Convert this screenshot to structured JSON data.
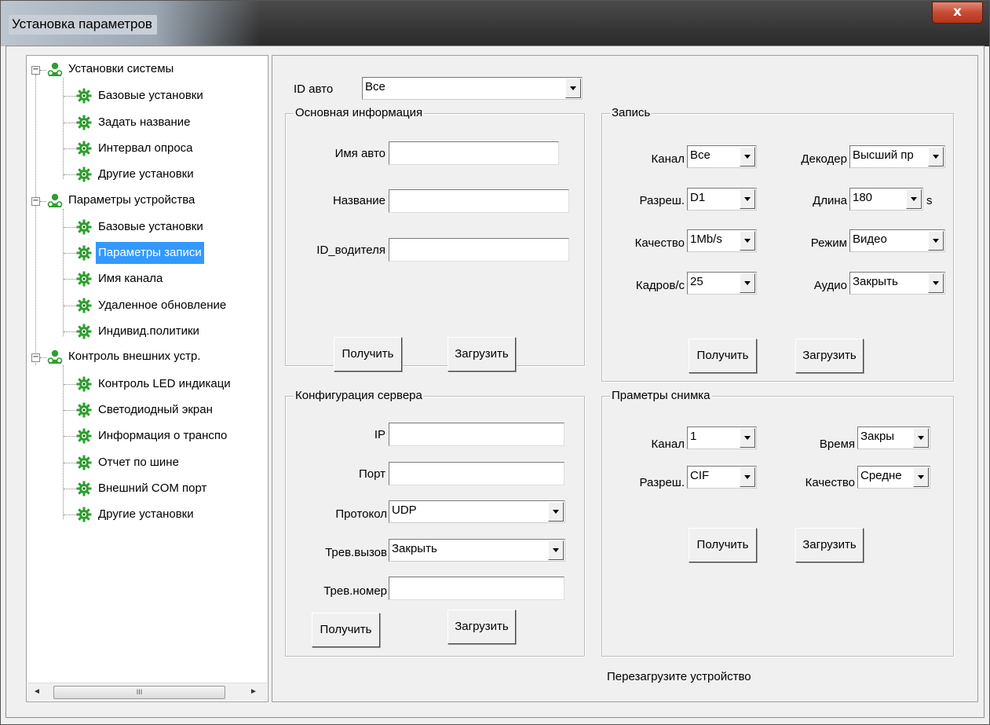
{
  "window": {
    "title": "Установка параметров",
    "close_glyph": "x"
  },
  "tree": {
    "groups": [
      {
        "label": "Установки системы",
        "expander": "−",
        "items": [
          "Базовые установки",
          "Задать название",
          "Интервал опроса",
          "Другие установки"
        ]
      },
      {
        "label": "Параметры устройства",
        "expander": "−",
        "items": [
          "Базовые установки",
          "Параметры записи",
          "Имя канала",
          "Удаленное обновление",
          "Индивид.политики"
        ]
      },
      {
        "label": "Контроль внешних устр.",
        "expander": "−",
        "items": [
          "Контроль LED индикаци",
          "Светодиодный экран",
          "Информация о транспо",
          "Отчет по шине",
          "Внешний COM порт",
          "Другие установки"
        ]
      }
    ],
    "selected": "Параметры записи",
    "scroll_thumb_glyph": "III",
    "scroll_left": "◄",
    "scroll_right": "►"
  },
  "vehicle": {
    "label": "ID авто",
    "value": "Все"
  },
  "basic_info": {
    "legend": "Основная информация",
    "name_label": "Имя авто",
    "name_value": "",
    "title_label": "Название",
    "title_value": "",
    "driver_label": "ID_водителя",
    "driver_value": "",
    "get_btn": "Получить",
    "upload_btn": "Загрузить"
  },
  "record": {
    "legend": "Запись",
    "channel_label": "Канал",
    "channel_value": "Все",
    "decoder_label": "Декодер",
    "decoder_value": "Высший пр",
    "resolution_label": "Разреш.",
    "resolution_value": "D1",
    "length_label": "Длина",
    "length_value": "180",
    "length_unit": "s",
    "quality_label": "Качество",
    "quality_value": "1Mb/s",
    "mode_label": "Режим",
    "mode_value": "Видео",
    "fps_label": "Кадров/с",
    "fps_value": "25",
    "audio_label": "Аудио",
    "audio_value": "Закрыть",
    "get_btn": "Получить",
    "upload_btn": "Загрузить"
  },
  "server": {
    "legend": "Конфигурация сервера",
    "ip_label": "IP",
    "ip_value": "",
    "port_label": "Порт",
    "port_value": "",
    "protocol_label": "Протокол",
    "protocol_value": "UDP",
    "alarm_call_label": "Трев.вызов",
    "alarm_call_value": "Закрыть",
    "alarm_number_label": "Трев.номер",
    "alarm_number_value": "",
    "get_btn": "Получить",
    "upload_btn": "Загрузить"
  },
  "snapshot": {
    "legend": "Праметры снимка",
    "channel_label": "Канал",
    "channel_value": "1",
    "time_label": "Время",
    "time_value": "Закры",
    "resolution_label": "Разреш.",
    "resolution_value": "CIF",
    "quality_label": "Качество",
    "quality_value": "Средне",
    "get_btn": "Получить",
    "upload_btn": "Загрузить"
  },
  "footer": {
    "reboot_text": "Перезагрузите устройство"
  },
  "colors": {
    "selection": "#3399ff",
    "node_icon_green": "#2e9e2e",
    "close_red": "#c74b33"
  }
}
